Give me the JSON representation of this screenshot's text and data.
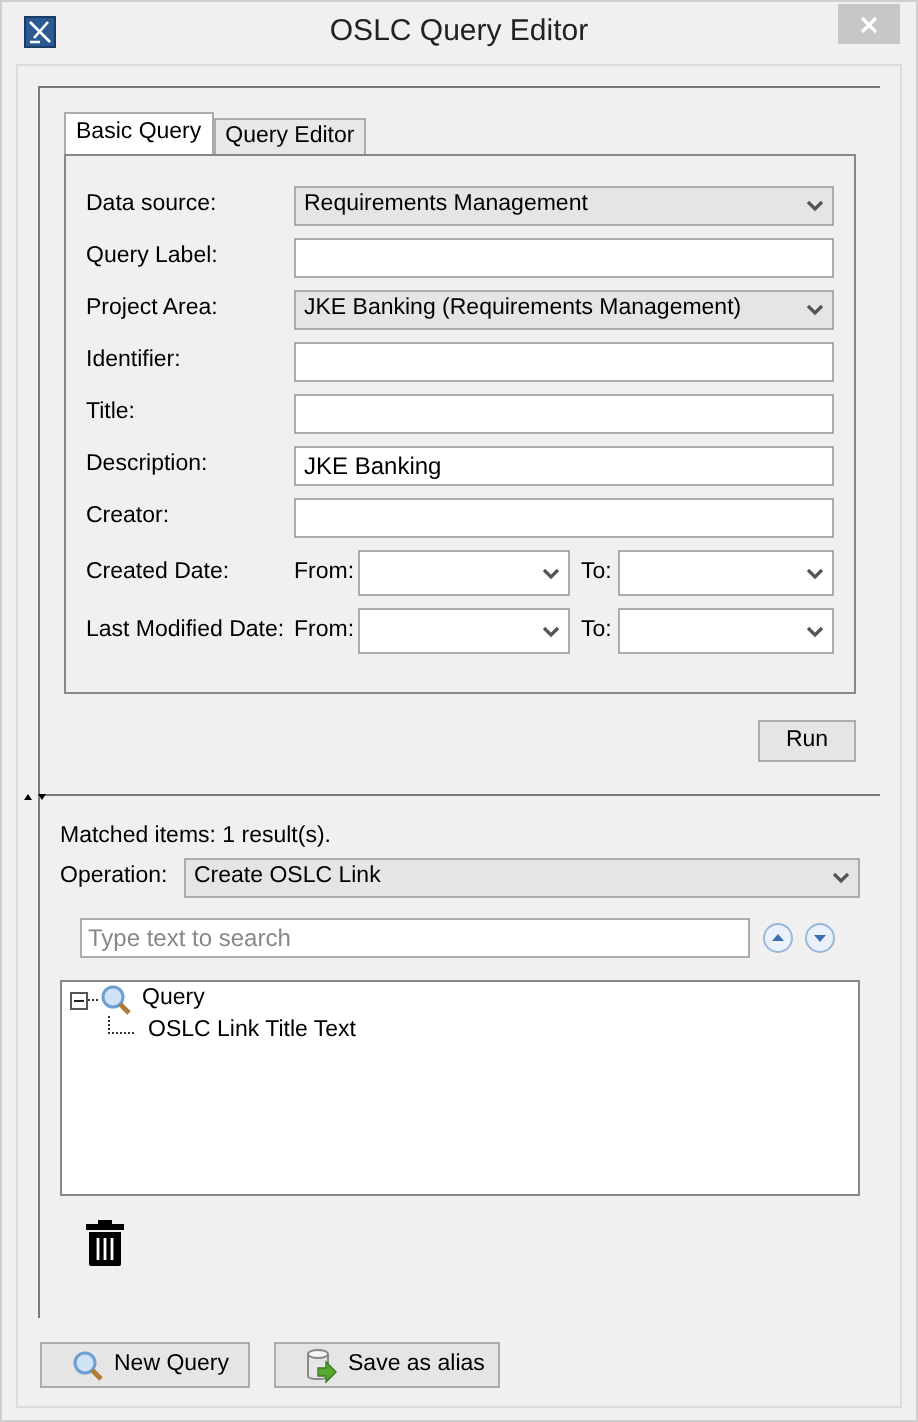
{
  "window": {
    "title": "OSLC Query Editor"
  },
  "tabs": [
    {
      "label": "Basic Query",
      "selected": true
    },
    {
      "label": "Query Editor",
      "selected": false
    }
  ],
  "form": [
    {
      "kind": "combo",
      "label": "Data source:",
      "value": "Requirements Management"
    },
    {
      "kind": "text",
      "label": "Query Label:"
    },
    {
      "kind": "combo",
      "label": "Project Area:",
      "value": "JKE Banking (Requirements Management)"
    },
    {
      "kind": "text",
      "label": "Identifier:"
    },
    {
      "kind": "text",
      "label": "Title:"
    },
    {
      "kind": "text",
      "label": "Description:",
      "value": "JKE Banking"
    },
    {
      "kind": "text",
      "label": "Creator:"
    },
    {
      "kind": "daterange",
      "label": "Created Date:",
      "from_label": "From:",
      "to_label": "To:"
    },
    {
      "kind": "daterange",
      "label": "Last Modified Date:",
      "from_label": "From:",
      "to_label": "To:"
    }
  ],
  "run_button": "Run",
  "results": {
    "matched": "Matched items: 1 result(s).",
    "operation_label": "Operation:",
    "operation_value": "Create OSLC Link",
    "search": {
      "placeholder": "Type text to search"
    }
  },
  "tree": [
    {
      "label": "Query",
      "expanded": true,
      "children": [
        {
          "label": "OSLC Link Title Text"
        }
      ]
    }
  ],
  "buttons": [
    {
      "kind": "new",
      "label": "New Query"
    },
    {
      "kind": "alias",
      "label": "Save as alias"
    }
  ]
}
